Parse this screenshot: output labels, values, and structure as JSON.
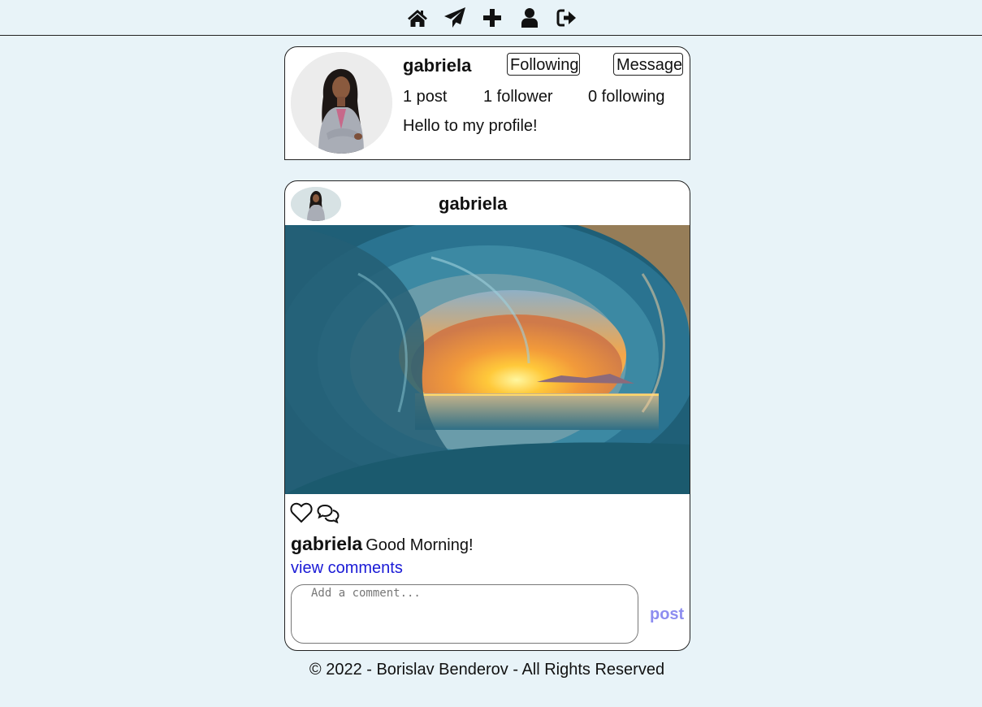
{
  "nav": {
    "icons": [
      "home-icon",
      "send-icon",
      "plus-icon",
      "user-icon",
      "sign-out-icon"
    ]
  },
  "profile": {
    "username": "gabriela",
    "following_button": "Following",
    "message_button": "Message",
    "posts": "1 post",
    "followers": "1 follower",
    "following": "0 following",
    "bio": "Hello to my profile!"
  },
  "post": {
    "username": "gabriela",
    "caption_user": "gabriela",
    "caption_text": "Good Morning!",
    "view_comments": "view comments",
    "comment_placeholder": "Add a comment...",
    "post_button": "post",
    "post_button_color": "#8d8df0"
  },
  "footer": {
    "text": "© 2022 - Borislav Benderov - All Rights Reserved"
  },
  "colors": {
    "background": "#e8f3f8",
    "link": "#1a1ad6"
  }
}
